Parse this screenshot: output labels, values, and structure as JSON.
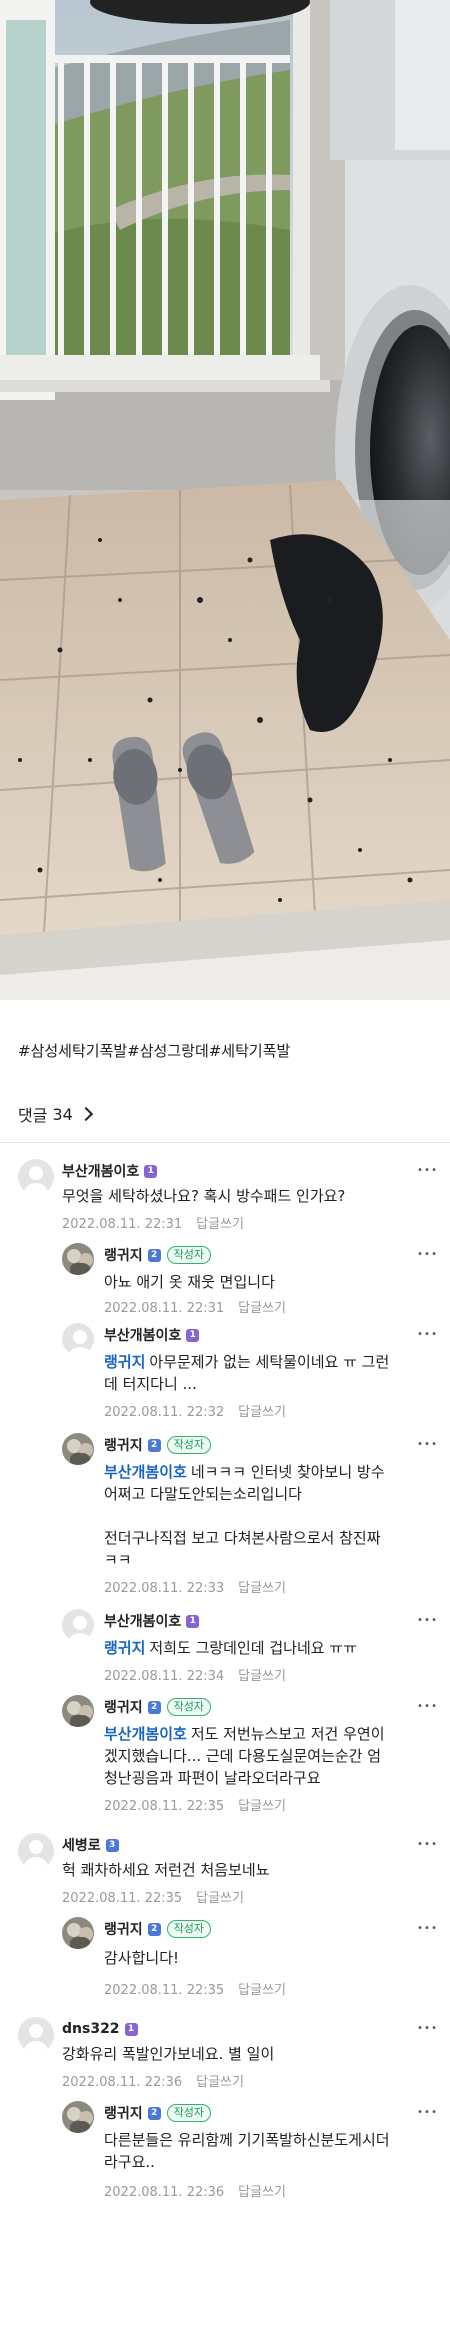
{
  "hashtags": "#삼성세탁기폭발#삼성그랑데#세탁기폭발",
  "comment_header": {
    "label": "댓글",
    "count": "34"
  },
  "reply_label": "답글쓰기",
  "writer_badge": "작성자",
  "colors": {
    "mention": "#1a65c4",
    "writer_badge": "#1c9d5a",
    "level_purple": "#8a63d2",
    "level_blue": "#4a78d8"
  },
  "comments": [
    {
      "nick": "부산개봄이호",
      "level": "1",
      "writer": false,
      "mention": "",
      "text": "무엇을 세탁하셨나요? 혹시 방수패드 인가요?",
      "date": "2022.08.11. 22:31"
    },
    {
      "nick": "랭귀지",
      "level": "2",
      "writer": true,
      "mention": "",
      "text": "아뇨 애기 옷 재웃 면입니다",
      "date": "2022.08.11. 22:31"
    },
    {
      "nick": "부산개봄이호",
      "level": "1",
      "writer": false,
      "mention": "랭귀지",
      "text": "아무문제가 없는 세탁물이네요 ㅠ 그런\n데 터지다니 ...",
      "date": "2022.08.11. 22:32"
    },
    {
      "nick": "랭귀지",
      "level": "2",
      "writer": true,
      "mention": "부산개봄이호",
      "text": "네ㅋㅋㅋ 인터넷 찾아보니 방수\n어쩌고 다말도안되는소리입니다\n\n전더구나직접 보고 다쳐본사람으로서 참진짜\nㅋㅋ",
      "date": "2022.08.11. 22:33"
    },
    {
      "nick": "부산개봄이호",
      "level": "1",
      "writer": false,
      "mention": "랭귀지",
      "text": "저희도 그랑데인데 겁나네요 ㅠㅠ",
      "date": "2022.08.11. 22:34"
    },
    {
      "nick": "랭귀지",
      "level": "2",
      "writer": true,
      "mention": "부산개봄이호",
      "text": "저도 저번뉴스보고 저건 우연이\n겠지했습니다... 근데 다용도실문여는순간 엄\n청난굉음과 파편이 날라오더라구요",
      "date": "2022.08.11. 22:35"
    },
    {
      "nick": "세병로",
      "level": "3",
      "writer": false,
      "mention": "",
      "text": "헉 쾌차하세요 저런건 처음보네뇨",
      "date": "2022.08.11. 22:35"
    },
    {
      "nick": "랭귀지",
      "level": "2",
      "writer": true,
      "mention": "",
      "text": "감사합니다!",
      "date": "2022.08.11. 22:35"
    },
    {
      "nick": "dns322",
      "level": "1",
      "writer": false,
      "mention": "",
      "text": "강화유리 폭발인가보네요. 별 일이",
      "date": "2022.08.11. 22:36"
    },
    {
      "nick": "랭귀지",
      "level": "2",
      "writer": true,
      "mention": "",
      "text": "다른분들은 유리함께 기기폭발하신분도게시더\n라구요..",
      "date": "2022.08.11. 22:36"
    }
  ]
}
